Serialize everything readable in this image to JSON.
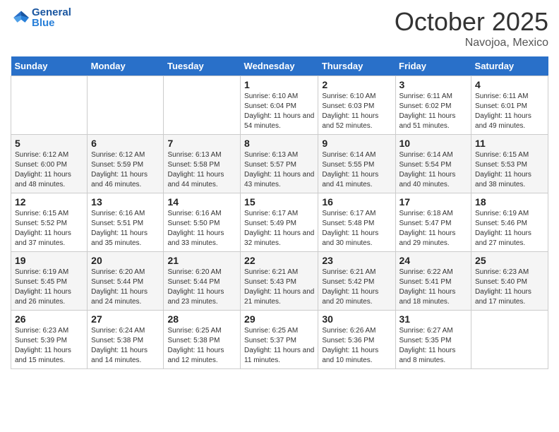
{
  "header": {
    "logo_general": "General",
    "logo_blue": "Blue",
    "month": "October 2025",
    "location": "Navojoa, Mexico"
  },
  "weekdays": [
    "Sunday",
    "Monday",
    "Tuesday",
    "Wednesday",
    "Thursday",
    "Friday",
    "Saturday"
  ],
  "weeks": [
    [
      {
        "day": "",
        "info": ""
      },
      {
        "day": "",
        "info": ""
      },
      {
        "day": "",
        "info": ""
      },
      {
        "day": "1",
        "info": "Sunrise: 6:10 AM\nSunset: 6:04 PM\nDaylight: 11 hours and 54 minutes."
      },
      {
        "day": "2",
        "info": "Sunrise: 6:10 AM\nSunset: 6:03 PM\nDaylight: 11 hours and 52 minutes."
      },
      {
        "day": "3",
        "info": "Sunrise: 6:11 AM\nSunset: 6:02 PM\nDaylight: 11 hours and 51 minutes."
      },
      {
        "day": "4",
        "info": "Sunrise: 6:11 AM\nSunset: 6:01 PM\nDaylight: 11 hours and 49 minutes."
      }
    ],
    [
      {
        "day": "5",
        "info": "Sunrise: 6:12 AM\nSunset: 6:00 PM\nDaylight: 11 hours and 48 minutes."
      },
      {
        "day": "6",
        "info": "Sunrise: 6:12 AM\nSunset: 5:59 PM\nDaylight: 11 hours and 46 minutes."
      },
      {
        "day": "7",
        "info": "Sunrise: 6:13 AM\nSunset: 5:58 PM\nDaylight: 11 hours and 44 minutes."
      },
      {
        "day": "8",
        "info": "Sunrise: 6:13 AM\nSunset: 5:57 PM\nDaylight: 11 hours and 43 minutes."
      },
      {
        "day": "9",
        "info": "Sunrise: 6:14 AM\nSunset: 5:55 PM\nDaylight: 11 hours and 41 minutes."
      },
      {
        "day": "10",
        "info": "Sunrise: 6:14 AM\nSunset: 5:54 PM\nDaylight: 11 hours and 40 minutes."
      },
      {
        "day": "11",
        "info": "Sunrise: 6:15 AM\nSunset: 5:53 PM\nDaylight: 11 hours and 38 minutes."
      }
    ],
    [
      {
        "day": "12",
        "info": "Sunrise: 6:15 AM\nSunset: 5:52 PM\nDaylight: 11 hours and 37 minutes."
      },
      {
        "day": "13",
        "info": "Sunrise: 6:16 AM\nSunset: 5:51 PM\nDaylight: 11 hours and 35 minutes."
      },
      {
        "day": "14",
        "info": "Sunrise: 6:16 AM\nSunset: 5:50 PM\nDaylight: 11 hours and 33 minutes."
      },
      {
        "day": "15",
        "info": "Sunrise: 6:17 AM\nSunset: 5:49 PM\nDaylight: 11 hours and 32 minutes."
      },
      {
        "day": "16",
        "info": "Sunrise: 6:17 AM\nSunset: 5:48 PM\nDaylight: 11 hours and 30 minutes."
      },
      {
        "day": "17",
        "info": "Sunrise: 6:18 AM\nSunset: 5:47 PM\nDaylight: 11 hours and 29 minutes."
      },
      {
        "day": "18",
        "info": "Sunrise: 6:19 AM\nSunset: 5:46 PM\nDaylight: 11 hours and 27 minutes."
      }
    ],
    [
      {
        "day": "19",
        "info": "Sunrise: 6:19 AM\nSunset: 5:45 PM\nDaylight: 11 hours and 26 minutes."
      },
      {
        "day": "20",
        "info": "Sunrise: 6:20 AM\nSunset: 5:44 PM\nDaylight: 11 hours and 24 minutes."
      },
      {
        "day": "21",
        "info": "Sunrise: 6:20 AM\nSunset: 5:44 PM\nDaylight: 11 hours and 23 minutes."
      },
      {
        "day": "22",
        "info": "Sunrise: 6:21 AM\nSunset: 5:43 PM\nDaylight: 11 hours and 21 minutes."
      },
      {
        "day": "23",
        "info": "Sunrise: 6:21 AM\nSunset: 5:42 PM\nDaylight: 11 hours and 20 minutes."
      },
      {
        "day": "24",
        "info": "Sunrise: 6:22 AM\nSunset: 5:41 PM\nDaylight: 11 hours and 18 minutes."
      },
      {
        "day": "25",
        "info": "Sunrise: 6:23 AM\nSunset: 5:40 PM\nDaylight: 11 hours and 17 minutes."
      }
    ],
    [
      {
        "day": "26",
        "info": "Sunrise: 6:23 AM\nSunset: 5:39 PM\nDaylight: 11 hours and 15 minutes."
      },
      {
        "day": "27",
        "info": "Sunrise: 6:24 AM\nSunset: 5:38 PM\nDaylight: 11 hours and 14 minutes."
      },
      {
        "day": "28",
        "info": "Sunrise: 6:25 AM\nSunset: 5:38 PM\nDaylight: 11 hours and 12 minutes."
      },
      {
        "day": "29",
        "info": "Sunrise: 6:25 AM\nSunset: 5:37 PM\nDaylight: 11 hours and 11 minutes."
      },
      {
        "day": "30",
        "info": "Sunrise: 6:26 AM\nSunset: 5:36 PM\nDaylight: 11 hours and 10 minutes."
      },
      {
        "day": "31",
        "info": "Sunrise: 6:27 AM\nSunset: 5:35 PM\nDaylight: 11 hours and 8 minutes."
      },
      {
        "day": "",
        "info": ""
      }
    ]
  ]
}
